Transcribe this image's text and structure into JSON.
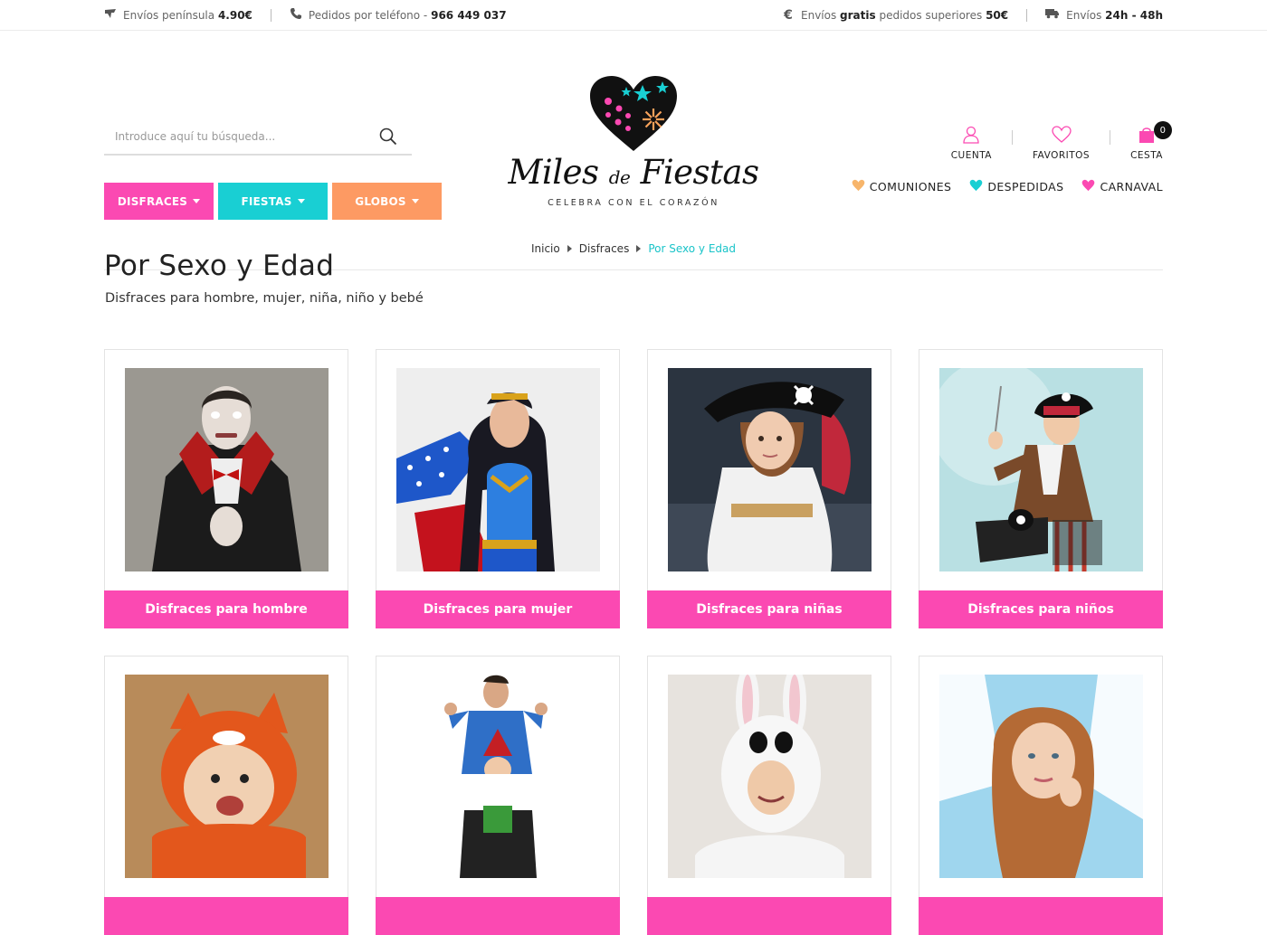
{
  "topbar": {
    "shipping_label": "Envíos península",
    "shipping_price": "4.90€",
    "phone_label": "Pedidos por teléfono -",
    "phone_number": "966 449 037",
    "free_pre": "Envíos",
    "free_bold": "gratis",
    "free_mid": "pedidos superiores",
    "free_amount": "50€",
    "delivery_label": "Envíos",
    "delivery_time": "24h - 48h"
  },
  "search": {
    "placeholder": "Introduce aquí tu búsqueda..."
  },
  "categories": [
    {
      "label": "DISFRACES",
      "color": "#fb49b2"
    },
    {
      "label": "FIESTAS",
      "color": "#19cfd3"
    },
    {
      "label": "GLOBOS",
      "color": "#fd9a63"
    }
  ],
  "logo": {
    "brand_a": "Miles",
    "brand_b": "de",
    "brand_c": "Fiestas",
    "tagline": "CELEBRA CON EL CORAZÓN"
  },
  "account": {
    "cuenta": "CUENTA",
    "favoritos": "FAVORITOS",
    "cesta": "CESTA",
    "cart_count": "0"
  },
  "themes": [
    {
      "label": "COMUNIONES",
      "color": "#f7b56b"
    },
    {
      "label": "DESPEDIDAS",
      "color": "#19cfd3"
    },
    {
      "label": "CARNAVAL",
      "color": "#fb49b2"
    }
  ],
  "breadcrumb": {
    "home": "Inicio",
    "parent": "Disfraces",
    "current": "Por Sexo y Edad"
  },
  "page": {
    "title": "Por Sexo y Edad",
    "subtitle": "Disfraces para hombre, mujer, niña, niño y bebé"
  },
  "cards": [
    {
      "label": "Disfraces para hombre",
      "icon": "vampire-man-photo"
    },
    {
      "label": "Disfraces para mujer",
      "icon": "superhero-woman-photo"
    },
    {
      "label": "Disfraces para niñas",
      "icon": "pirate-girl-photo"
    },
    {
      "label": "Disfraces para niños",
      "icon": "pirate-boy-photo"
    },
    {
      "label": "",
      "icon": "fox-baby-photo"
    },
    {
      "label": "",
      "icon": "gnome-rider-photo"
    },
    {
      "label": "",
      "icon": "bunny-costume-photo"
    },
    {
      "label": "",
      "icon": "angel-woman-photo"
    }
  ],
  "colors": {
    "accent_pink": "#fb49b2",
    "accent_teal": "#19cfd3",
    "accent_orange": "#fd9a63"
  }
}
